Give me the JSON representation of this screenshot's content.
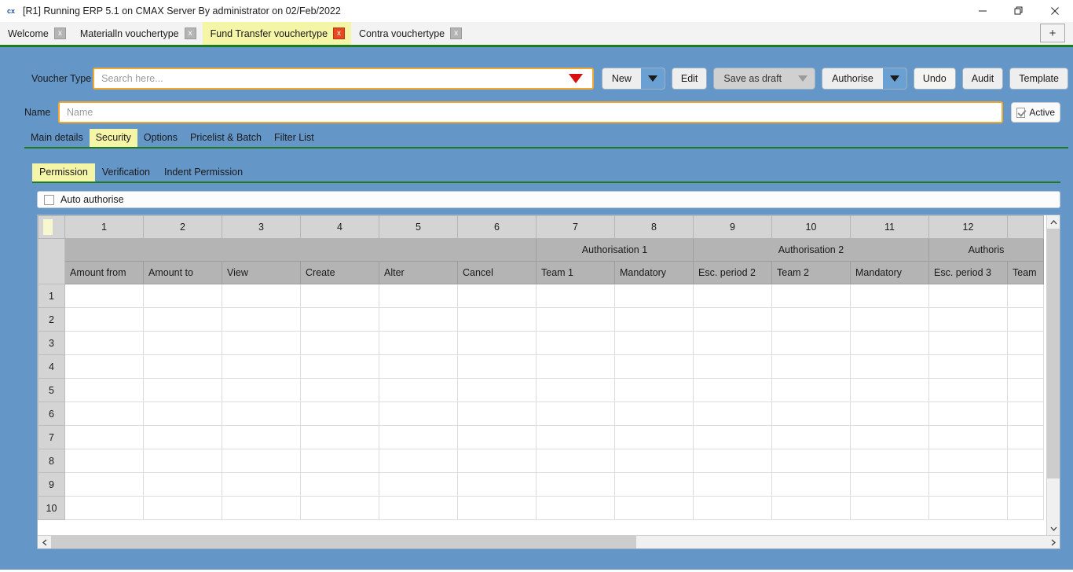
{
  "window": {
    "title": "[R1] Running ERP 5.1 on CMAX Server By administrator on 02/Feb/2022",
    "app_icon": "cx",
    "controls": {
      "minimize": "minimize-icon",
      "maximize": "restore-icon",
      "close": "close-icon"
    }
  },
  "tabstrip": {
    "tabs": [
      {
        "label": "Welcome",
        "active": false,
        "close": "x"
      },
      {
        "label": "Materialln vouchertype",
        "active": false,
        "close": "x"
      },
      {
        "label": "Fund Transfer vouchertype",
        "active": true,
        "close": "x"
      },
      {
        "label": "Contra vouchertype",
        "active": false,
        "close": "x"
      }
    ],
    "new_tab_label": "+"
  },
  "form": {
    "voucher_type_label": "Voucher Type",
    "voucher_type_placeholder": "Search here...",
    "voucher_type_value": "",
    "name_label": "Name",
    "name_placeholder": "Name",
    "name_value": "",
    "active_label": "Active",
    "active_checked": true
  },
  "toolbar": {
    "buttons": [
      {
        "label": "New",
        "type": "split",
        "state": "enabled"
      },
      {
        "label": "Edit",
        "type": "plain",
        "state": "enabled"
      },
      {
        "label": "Save as draft",
        "type": "split",
        "state": "disabled"
      },
      {
        "label": "Authorise",
        "type": "split",
        "state": "enabled"
      },
      {
        "label": "Undo",
        "type": "plain",
        "state": "enabled"
      },
      {
        "label": "Audit",
        "type": "plain",
        "state": "enabled"
      },
      {
        "label": "Template",
        "type": "plain",
        "state": "enabled"
      }
    ]
  },
  "tabs_primary": {
    "items": [
      {
        "label": "Main details",
        "active": false
      },
      {
        "label": "Security",
        "active": true
      },
      {
        "label": "Options",
        "active": false
      },
      {
        "label": "Pricelist & Batch",
        "active": false
      },
      {
        "label": "Filter List",
        "active": false
      }
    ]
  },
  "tabs_secondary": {
    "items": [
      {
        "label": "Permission",
        "active": true
      },
      {
        "label": "Verification",
        "active": false
      },
      {
        "label": "Indent Permission",
        "active": false
      }
    ]
  },
  "auto_authorise": {
    "label": "Auto authorise",
    "checked": false
  },
  "grid": {
    "column_numbers": [
      "1",
      "2",
      "3",
      "4",
      "5",
      "6",
      "7",
      "8",
      "9",
      "10",
      "11",
      "12",
      ""
    ],
    "groups": [
      {
        "label": "",
        "span": 6
      },
      {
        "label": "Authorisation 1",
        "span": 2
      },
      {
        "label": "Authorisation 2",
        "span": 3
      },
      {
        "label": "Authoris",
        "span": 2
      }
    ],
    "field_headers": [
      "Amount from",
      "Amount to",
      "View",
      "Create",
      "Alter",
      "Cancel",
      "Team 1",
      "Mandatory",
      "Esc. period 2",
      "Team 2",
      "Mandatory",
      "Esc. period 3",
      "Team"
    ],
    "row_numbers": [
      "1",
      "2",
      "3",
      "4",
      "5",
      "6",
      "7",
      "8",
      "9",
      "10"
    ],
    "rows": [
      [
        "",
        "",
        "",
        "",
        "",
        "",
        "",
        "",
        "",
        "",
        "",
        "",
        ""
      ],
      [
        "",
        "",
        "",
        "",
        "",
        "",
        "",
        "",
        "",
        "",
        "",
        "",
        ""
      ],
      [
        "",
        "",
        "",
        "",
        "",
        "",
        "",
        "",
        "",
        "",
        "",
        "",
        ""
      ],
      [
        "",
        "",
        "",
        "",
        "",
        "",
        "",
        "",
        "",
        "",
        "",
        "",
        ""
      ],
      [
        "",
        "",
        "",
        "",
        "",
        "",
        "",
        "",
        "",
        "",
        "",
        "",
        ""
      ],
      [
        "",
        "",
        "",
        "",
        "",
        "",
        "",
        "",
        "",
        "",
        "",
        "",
        ""
      ],
      [
        "",
        "",
        "",
        "",
        "",
        "",
        "",
        "",
        "",
        "",
        "",
        "",
        ""
      ],
      [
        "",
        "",
        "",
        "",
        "",
        "",
        "",
        "",
        "",
        "",
        "",
        "",
        ""
      ],
      [
        "",
        "",
        "",
        "",
        "",
        "",
        "",
        "",
        "",
        "",
        "",
        "",
        ""
      ],
      [
        "",
        "",
        "",
        "",
        "",
        "",
        "",
        "",
        "",
        "",
        "",
        "",
        ""
      ]
    ]
  },
  "colors": {
    "app_background": "#6496c8",
    "active_tab": "#f5f5a8",
    "accent_green": "#1f7a1f",
    "input_border": "#f0a830",
    "dropdown_red": "#d81010",
    "close_active": "#e8471f"
  }
}
